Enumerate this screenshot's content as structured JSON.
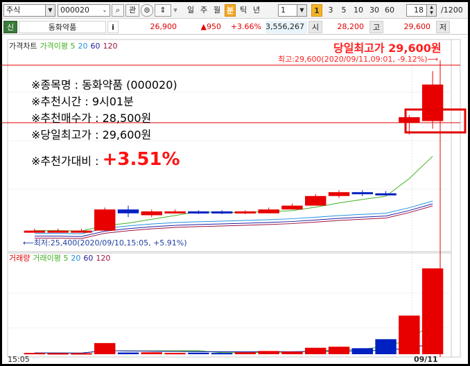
{
  "toolbar": {
    "market": "주식",
    "code": "000020",
    "search_btn": "⌕",
    "gwan_btn": "관",
    "periods": [
      {
        "label": "일",
        "active": false
      },
      {
        "label": "주",
        "active": false
      },
      {
        "label": "월",
        "active": false
      },
      {
        "label": "분",
        "active": true
      },
      {
        "label": "틱",
        "active": false
      },
      {
        "label": "년",
        "active": false
      }
    ],
    "interval": "1",
    "minute_buttons": [
      {
        "label": "1",
        "active": true
      },
      {
        "label": "3",
        "active": false
      },
      {
        "label": "5",
        "active": false
      },
      {
        "label": "10",
        "active": false
      },
      {
        "label": "30",
        "active": false
      },
      {
        "label": "60",
        "active": false
      }
    ],
    "bar_count": "18",
    "display_count": "/1200"
  },
  "quote": {
    "badge": "신",
    "name": "동화약품",
    "info": "i",
    "price": "26,900",
    "change": "▲950",
    "change_pct": "+3.66%",
    "volume": "3,556,267",
    "open_label": "시",
    "open": "28,200",
    "high_label": "고",
    "high": "29,600",
    "low_label": "저"
  },
  "price_panel": {
    "legend": {
      "title": "가격차트",
      "ma_label": "가격이평 5",
      "ma20": "20",
      "ma60": "60",
      "ma120": "120"
    },
    "headline": "당일최고가 29,600원",
    "high_note": "최고:29,600(2020/09/11,09:01, -9.12%)⟶",
    "low_note": "⟵최저:25,400(2020/09/10,15:05, +5.91%)"
  },
  "notes": {
    "stock_name": "※종목명 : 동화약품 (000020)",
    "rec_time": "※추천시간 : 9시01분",
    "rec_price": "※추천매수가 : 28,500원",
    "day_high": "※당일최고가 : 29,600원",
    "ratio_label": "※추천가대비 :",
    "ratio_value": "+3.51%"
  },
  "volume_panel": {
    "legend": {
      "title": "거래량",
      "ma_label": "거래이평 5",
      "ma20": "20",
      "ma60": "60",
      "ma120": "120"
    }
  },
  "x_axis": {
    "left": "15:05",
    "right": "09/11"
  },
  "colors": {
    "up": "#e80000",
    "down": "#0020c0",
    "ma5": "#40b020",
    "ma20": "#2090e0",
    "ma60": "#2020a0",
    "ma120": "#a01040",
    "accent": "#f5a623"
  },
  "chart_data": {
    "type": "candlestick",
    "candles": [
      {
        "open": 25400,
        "high": 25500,
        "low": 25400,
        "close": 25450,
        "color": "up"
      },
      {
        "open": 25450,
        "high": 25500,
        "low": 25400,
        "close": 25450,
        "color": "up"
      },
      {
        "open": 25450,
        "high": 25500,
        "low": 25400,
        "close": 25420,
        "color": "up"
      },
      {
        "open": 25450,
        "high": 26050,
        "low": 25450,
        "close": 26000,
        "color": "up"
      },
      {
        "open": 26000,
        "high": 26100,
        "low": 25800,
        "close": 25900,
        "color": "down"
      },
      {
        "open": 25850,
        "high": 26000,
        "low": 25800,
        "close": 25950,
        "color": "up"
      },
      {
        "open": 25950,
        "high": 26000,
        "low": 25900,
        "close": 25950,
        "color": "up"
      },
      {
        "open": 25950,
        "high": 25980,
        "low": 25880,
        "close": 25900,
        "color": "down"
      },
      {
        "open": 25950,
        "high": 25980,
        "low": 25880,
        "close": 25900,
        "color": "down"
      },
      {
        "open": 25900,
        "high": 25980,
        "low": 25880,
        "close": 25950,
        "color": "up"
      },
      {
        "open": 25900,
        "high": 26050,
        "low": 25900,
        "close": 26000,
        "color": "up"
      },
      {
        "open": 26000,
        "high": 26150,
        "low": 26000,
        "close": 26100,
        "color": "up"
      },
      {
        "open": 26100,
        "high": 26400,
        "low": 26100,
        "close": 26350,
        "color": "up"
      },
      {
        "open": 26350,
        "high": 26500,
        "low": 26300,
        "close": 26450,
        "color": "up"
      },
      {
        "open": 26450,
        "high": 26500,
        "low": 26350,
        "close": 26400,
        "color": "down"
      },
      {
        "open": 26400,
        "high": 26480,
        "low": 26380,
        "close": 26420,
        "color": "down"
      },
      {
        "open": 28250,
        "high": 28450,
        "low": 27950,
        "close": 28400,
        "color": "up"
      },
      {
        "open": 28300,
        "high": 29600,
        "low": 28100,
        "close": 29250,
        "color": "up"
      }
    ],
    "volumes": [
      6000,
      5000,
      5000,
      52000,
      8000,
      9000,
      6000,
      7000,
      6000,
      9000,
      15000,
      12000,
      30000,
      35000,
      28000,
      70000,
      180000,
      400000
    ],
    "price_range": [
      25300,
      29700
    ],
    "volume_max": 420000
  }
}
